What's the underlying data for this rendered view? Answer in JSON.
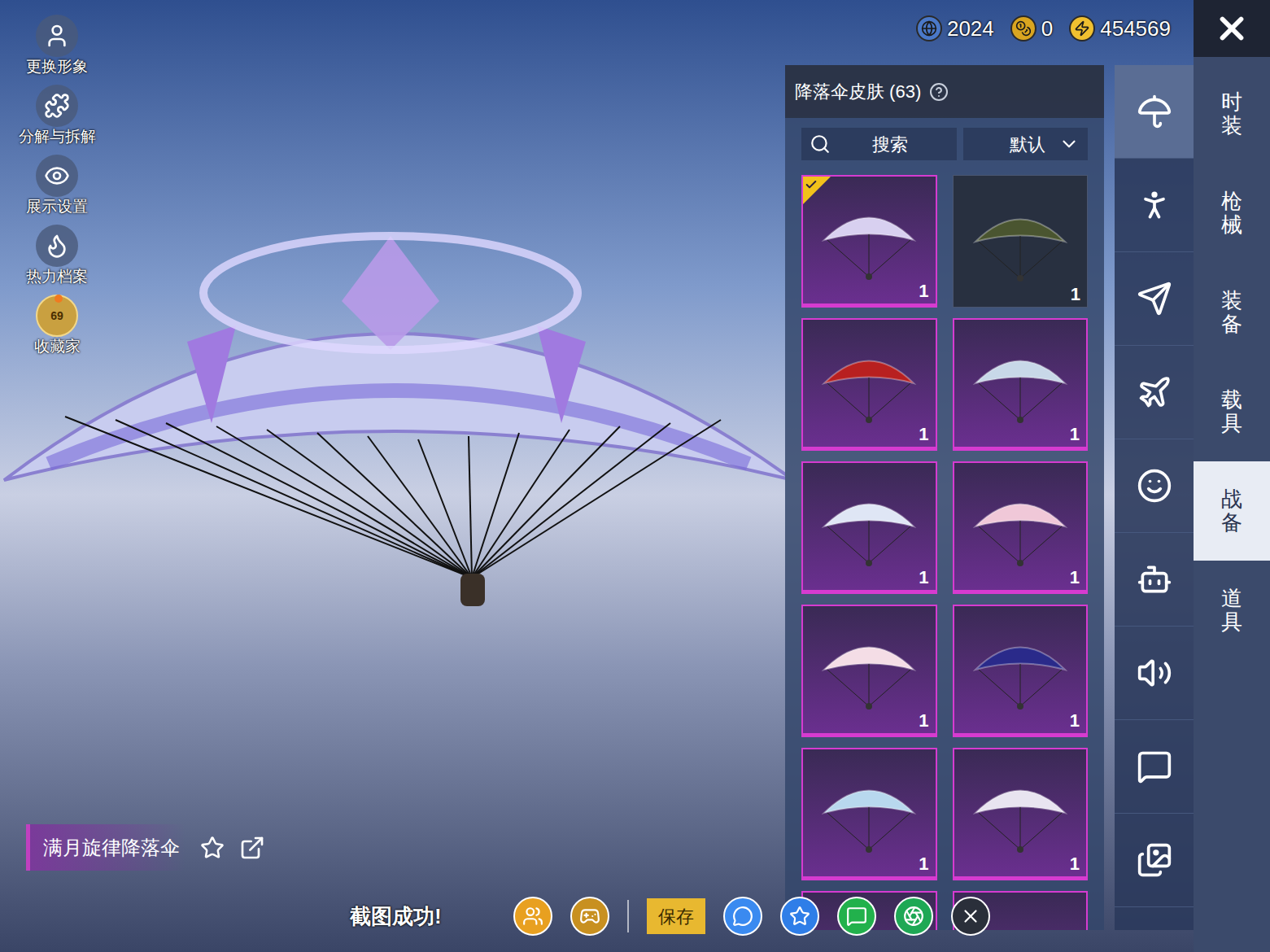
{
  "left_menu": [
    {
      "label": "更换形象"
    },
    {
      "label": "分解与拆解"
    },
    {
      "label": "展示设置"
    },
    {
      "label": "热力档案"
    },
    {
      "label": "收藏家",
      "badge": "69",
      "notification": true
    }
  ],
  "currencies": [
    {
      "value": "2024",
      "color": "#4a78c8"
    },
    {
      "value": "0",
      "color": "#d9a520"
    },
    {
      "value": "454569",
      "color": "#f0c030"
    }
  ],
  "panel": {
    "title": "降落伞皮肤 (63)",
    "search": {
      "placeholder": "搜索"
    },
    "sort": {
      "value": "默认"
    }
  },
  "items": [
    {
      "count": "1",
      "selected": true,
      "kind": "premium",
      "color": "#d8d0f0"
    },
    {
      "count": "1",
      "selected": false,
      "kind": "basic",
      "color": "#4a5530"
    },
    {
      "count": "1",
      "selected": false,
      "kind": "premium",
      "color": "#b82020"
    },
    {
      "count": "1",
      "selected": false,
      "kind": "premium",
      "color": "#c8d8e8"
    },
    {
      "count": "1",
      "selected": false,
      "kind": "premium",
      "color": "#dfe6f5"
    },
    {
      "count": "1",
      "selected": false,
      "kind": "premium",
      "color": "#f0c8d8"
    },
    {
      "count": "1",
      "selected": false,
      "kind": "premium",
      "color": "#f4dde6"
    },
    {
      "count": "1",
      "selected": false,
      "kind": "premium",
      "color": "#2a2a8a"
    },
    {
      "count": "1",
      "selected": false,
      "kind": "premium",
      "color": "#b8d8ee"
    },
    {
      "count": "1",
      "selected": false,
      "kind": "premium",
      "color": "#e8e4f0"
    },
    {
      "selected": false,
      "kind": "premium",
      "color": "#5a3a7a"
    },
    {
      "selected": false,
      "kind": "premium",
      "color": "#5a3a7a"
    }
  ],
  "categories": [
    {
      "selected": true
    },
    {
      "selected": false
    },
    {
      "selected": false
    },
    {
      "selected": false
    },
    {
      "selected": false
    },
    {
      "selected": false
    },
    {
      "selected": false
    },
    {
      "selected": false
    },
    {
      "selected": false
    }
  ],
  "tabs": [
    {
      "label": "时装",
      "selected": false
    },
    {
      "label": "枪械",
      "selected": false
    },
    {
      "label": "装备",
      "selected": false
    },
    {
      "label": "载具",
      "selected": false
    },
    {
      "label": "战备",
      "selected": true
    },
    {
      "label": "道具",
      "selected": false
    }
  ],
  "item_name": "满月旋律降落伞",
  "toast": "截图成功!",
  "save_button": "保存",
  "share_targets": [
    {
      "color": "#e8a020"
    },
    {
      "color": "#c89020"
    },
    {
      "color": "#3a8af0"
    },
    {
      "color": "#2f7ee8"
    },
    {
      "color": "#22b14c"
    },
    {
      "color": "#1fa855"
    },
    {
      "color": "#2a2f3a"
    }
  ]
}
